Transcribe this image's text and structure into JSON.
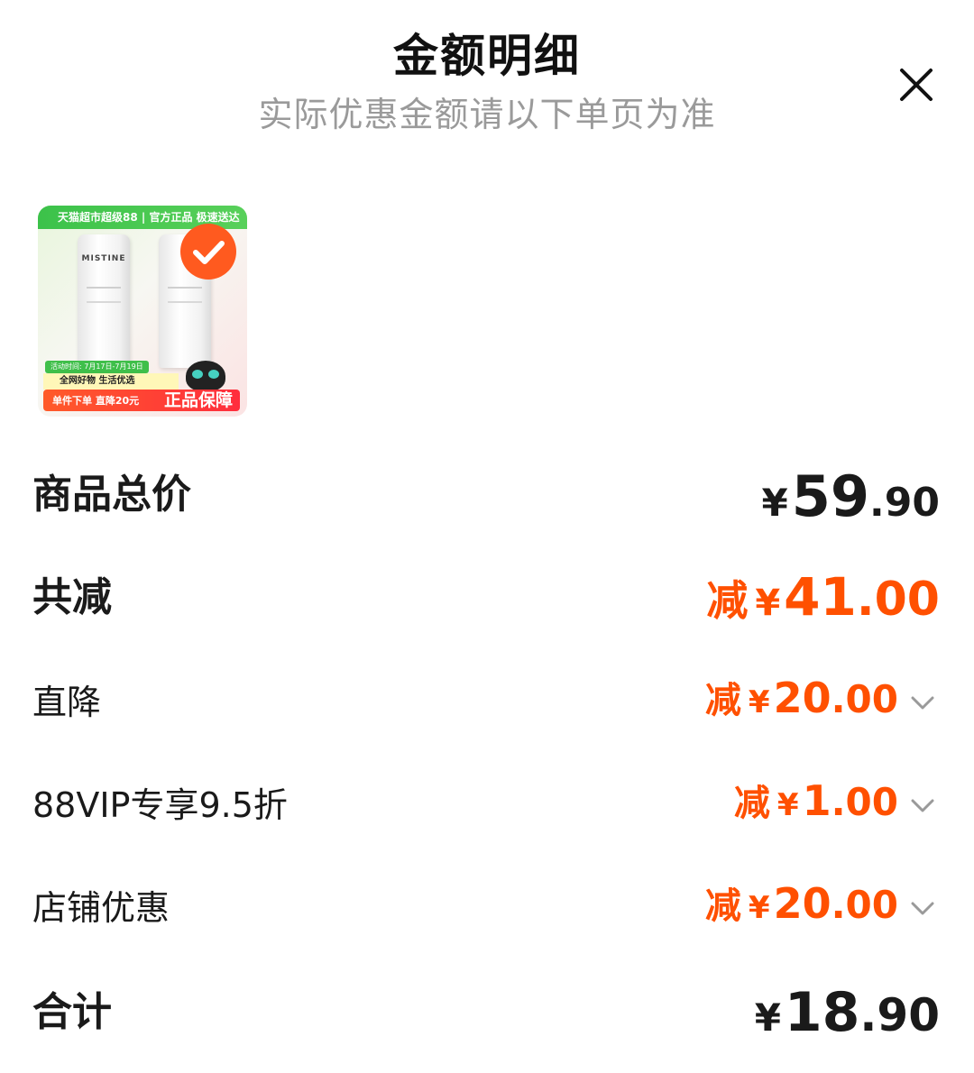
{
  "header": {
    "title": "金额明细",
    "subtitle": "实际优惠金额请以下单页为准"
  },
  "product": {
    "banner_text": "天猫超市超级88 | 官方正品 极速送达",
    "brand": "MISTINE",
    "activity_text": "活动时间: 7月17日-7月19日",
    "promo_line": "全网好物 生活优选",
    "discount_text": "单件下单 直降20元",
    "guarantee_text": "正品保障",
    "selected": true
  },
  "rows": {
    "total_price": {
      "label": "商品总价",
      "currency": "¥",
      "integer": "59",
      "decimal": ".90"
    },
    "total_discount": {
      "label": "共减",
      "prefix": "减",
      "currency": "¥",
      "integer": "41",
      "decimal": ".00"
    },
    "direct_discount": {
      "label": "直降",
      "prefix": "减",
      "currency": "¥",
      "integer": "20",
      "decimal": ".00"
    },
    "vip_discount": {
      "label": "88VIP专享9.5折",
      "prefix": "减",
      "currency": "¥",
      "integer": "1",
      "decimal": ".00"
    },
    "store_discount": {
      "label": "店铺优惠",
      "prefix": "减",
      "currency": "¥",
      "integer": "20",
      "decimal": ".00"
    },
    "grand_total": {
      "label": "合计",
      "currency": "¥",
      "integer": "18",
      "decimal": ".90"
    }
  },
  "colors": {
    "accent": "#ff5000",
    "text": "#1a1a1a",
    "subtitle": "#9a9a9a"
  },
  "icons": {
    "close": "close-icon",
    "chevron": "chevron-down-icon",
    "check": "checkmark-icon"
  }
}
